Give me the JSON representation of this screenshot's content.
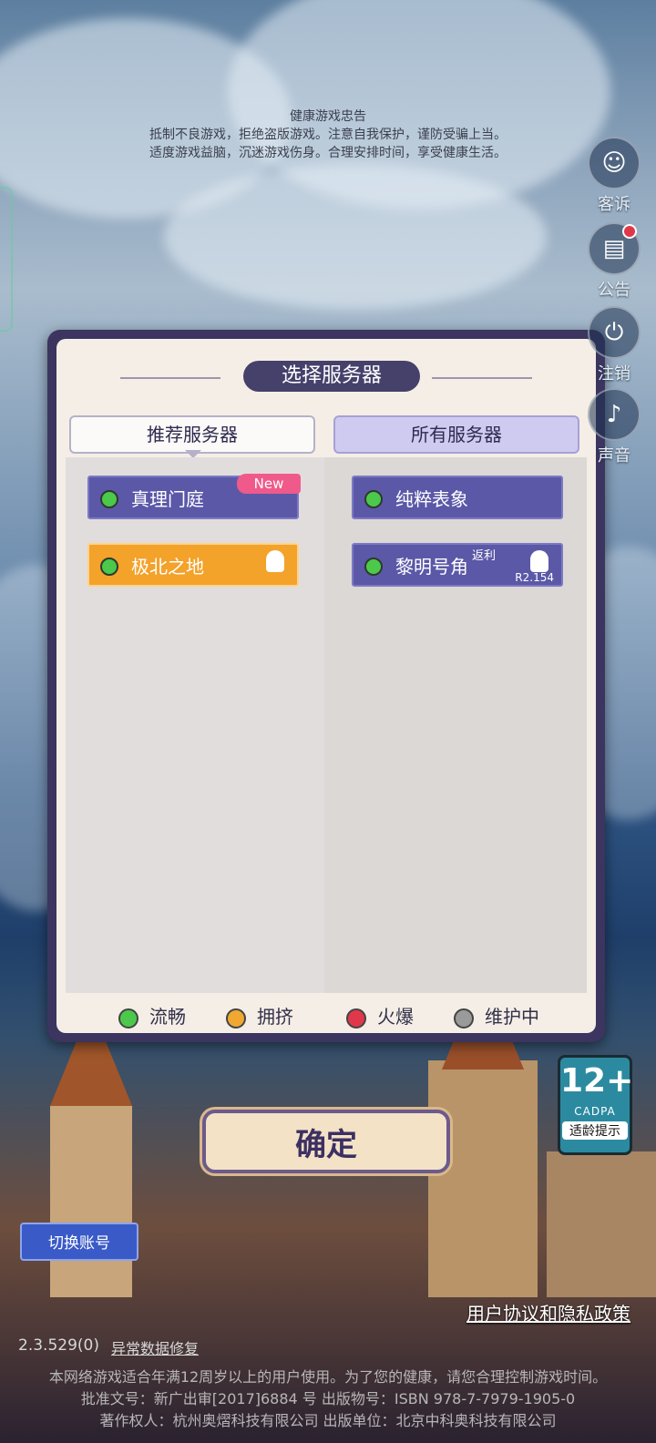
{
  "notice": {
    "title": "健康游戏忠告",
    "line1": "抵制不良游戏，拒绝盗版游戏。注意自我保护，谨防受骗上当。",
    "line2": "适度游戏益脑，沉迷游戏伤身。合理安排时间，享受健康生活。"
  },
  "side": {
    "service_label": "客诉",
    "announce_label": "公告",
    "logout_label": "注销",
    "sound_label": "声音"
  },
  "panel": {
    "title": "选择服务器",
    "tab_recommended": "推荐服务器",
    "tab_all": "所有服务器",
    "recommended": [
      {
        "name": "真理门庭",
        "badge": "New",
        "status": "流畅"
      },
      {
        "name": "极北之地",
        "status": "流畅"
      }
    ],
    "all": [
      {
        "name": "纯粹表象",
        "status": "流畅"
      },
      {
        "name": "黎明号角",
        "tag": "返利",
        "version": "R2.154",
        "status": "流畅"
      }
    ],
    "legend": [
      "流畅",
      "拥挤",
      "火爆",
      "维护中"
    ]
  },
  "colors": {
    "smooth": "#4cc94a",
    "busy": "#f0a833",
    "hot": "#e0384a",
    "maintenance": "#9a9a9a"
  },
  "confirm_label": "确定",
  "switch_account_label": "切换账号",
  "age_rating": {
    "age": "12+",
    "org": "CADPA",
    "hint": "适龄提示"
  },
  "policy_link": "用户协议和隐私政策",
  "version": "2.3.529(0)",
  "repair_link": "异常数据修复",
  "footer": {
    "line1": "本网络游戏适合年满12周岁以上的用户使用。为了您的健康，请您合理控制游戏时间。",
    "line2": "批准文号：新广出审[2017]6884 号 出版物号：ISBN 978-7-7979-1905-0",
    "line3": "著作权人：杭州奥熠科技有限公司 出版单位：北京中科奥科技有限公司"
  }
}
